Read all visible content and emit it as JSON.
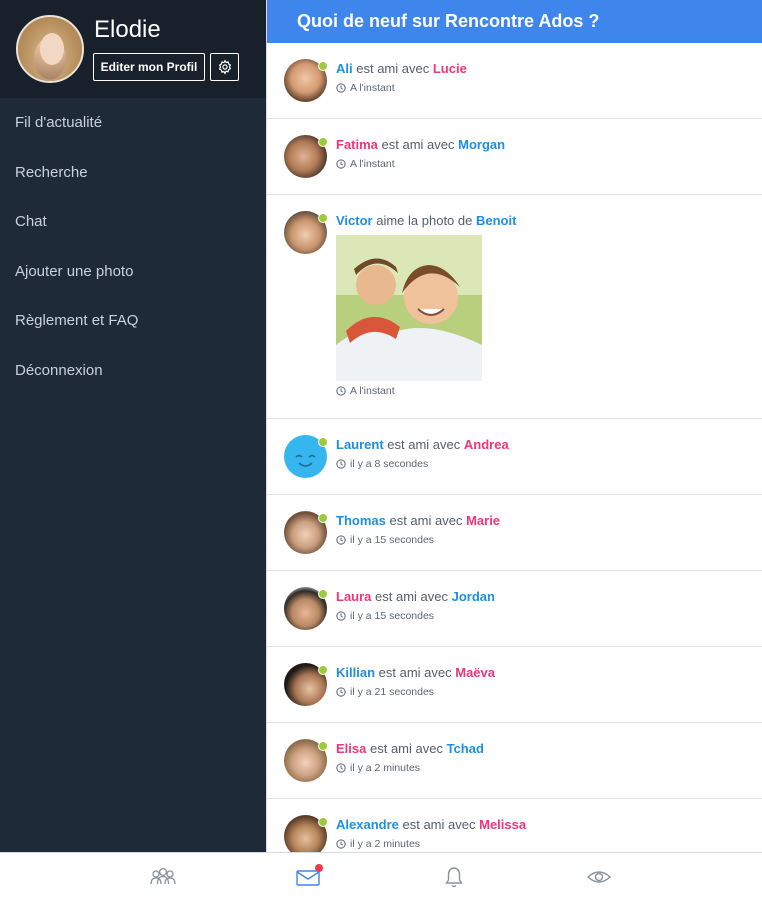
{
  "profile": {
    "name": "Elodie",
    "edit_label": "Editer mon Profil"
  },
  "menu": [
    {
      "label": "Fil d'actualité"
    },
    {
      "label": "Recherche"
    },
    {
      "label": "Chat"
    },
    {
      "label": "Ajouter une photo"
    },
    {
      "label": "Règlement et FAQ"
    },
    {
      "label": "Déconnexion"
    }
  ],
  "feed": {
    "title": "Quoi de neuf sur Rencontre Ados ?",
    "items": [
      {
        "actor": "Ali",
        "verb": "est ami avec",
        "target": "Lucie",
        "time": "A l'instant"
      },
      {
        "actor": "Fatima",
        "verb": "est ami avec",
        "target": "Morgan",
        "time": "A l'instant"
      },
      {
        "actor": "Victor",
        "verb": "aime la photo de",
        "target": "Benoit",
        "time": "A l'instant"
      },
      {
        "actor": "Laurent",
        "verb": "est ami avec",
        "target": "Andrea",
        "time": "il y a 8 secondes"
      },
      {
        "actor": "Thomas",
        "verb": "est ami avec",
        "target": "Marie",
        "time": "il y a 15 secondes"
      },
      {
        "actor": "Laura",
        "verb": "est ami avec",
        "target": "Jordan",
        "time": "il y a 15 secondes"
      },
      {
        "actor": "Killian",
        "verb": "est ami avec",
        "target": "Maëva",
        "time": "il y a 21 secondes"
      },
      {
        "actor": "Elisa",
        "verb": "est ami avec",
        "target": "Tchad",
        "time": "il y a 2 minutes"
      },
      {
        "actor": "Alexandre",
        "verb": "est ami avec",
        "target": "Melissa",
        "time": "il y a 2 minutes"
      }
    ]
  },
  "bottom_tabs": [
    {
      "icon": "people-icon"
    },
    {
      "icon": "mail-icon",
      "has_notification": true
    },
    {
      "icon": "bell-icon"
    },
    {
      "icon": "eye-icon"
    }
  ],
  "colors": {
    "header_blue": "#3f86ec",
    "sidebar_bg": "#1e2a38",
    "profile_bg": "#17202b",
    "name_blue": "#1e8fe0",
    "name_pink": "#f0357a",
    "online_green": "#9ccc3c",
    "notification_red": "#f0384b"
  }
}
